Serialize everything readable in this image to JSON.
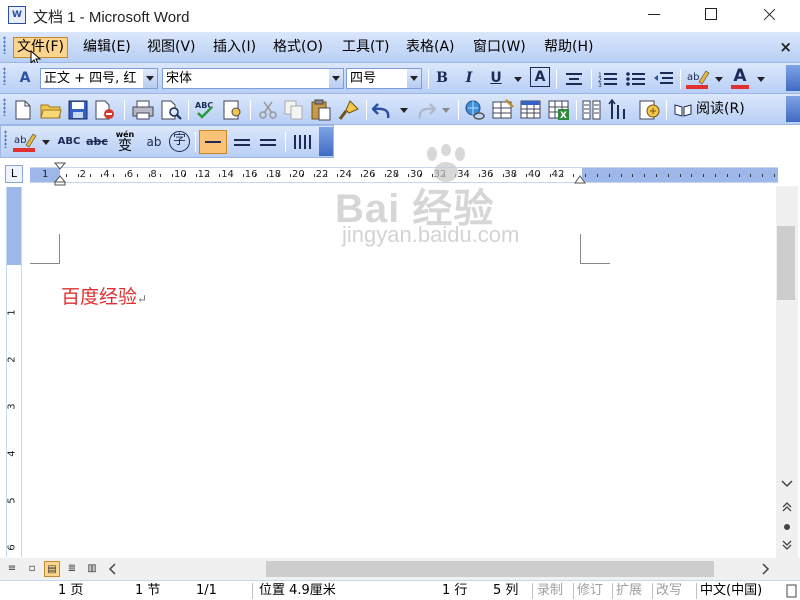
{
  "window": {
    "title": "文档 1 - Microsoft Word",
    "app_icon": "W"
  },
  "menu": {
    "items": [
      "文件(F)",
      "编辑(E)",
      "视图(V)",
      "插入(I)",
      "格式(O)",
      "工具(T)",
      "表格(A)",
      "窗口(W)",
      "帮助(H)"
    ],
    "active_index": 0,
    "close_glyph": "×"
  },
  "format": {
    "style_value": "正文 + 四号, 红",
    "font_value": "宋体",
    "size_value": "四号",
    "bold": "B",
    "italic": "I",
    "underline": "U",
    "char_border": "A",
    "font_color_glyph": "A"
  },
  "standard": {
    "read_label": "阅读(R)"
  },
  "small": {
    "glyph_abc": "ABC",
    "glyph_strike": "abc",
    "glyph_pinyin": "wén",
    "glyph_bian": "变",
    "glyph_zhu": "ab",
    "glyph_zi": "字"
  },
  "ruler": {
    "tab_glyph": "L",
    "left_numbers": [
      "1"
    ],
    "numbers": [
      "2",
      "4",
      "6",
      "8",
      "10",
      "12",
      "14",
      "16",
      "18",
      "20",
      "22",
      "24",
      "26",
      "28",
      "30",
      "32",
      "34",
      "36",
      "38",
      "40",
      "42"
    ],
    "vertical_numbers": [
      "1",
      "2",
      "3",
      "4",
      "5",
      "6"
    ]
  },
  "document": {
    "text": "百度经验",
    "paragraph_mark": "↵",
    "text_color": "#e03030"
  },
  "watermark": {
    "main": "Bai 经验",
    "sub": "jingyan.baidu.com"
  },
  "status": {
    "page": "1 页",
    "section": "1 节",
    "page_of": "1/1",
    "position": "位置 4.9厘米",
    "line": "1 行",
    "col": "5 列",
    "rec": "录制",
    "trk": "修订",
    "ext": "扩展",
    "ovr": "改写",
    "lang": "中文(中国)"
  },
  "colors": {
    "toolbar_top": "#dbe7fb",
    "toolbar_bottom": "#b8cff5",
    "active_menu": "#fbd48e",
    "doc_text": "#e03030"
  }
}
